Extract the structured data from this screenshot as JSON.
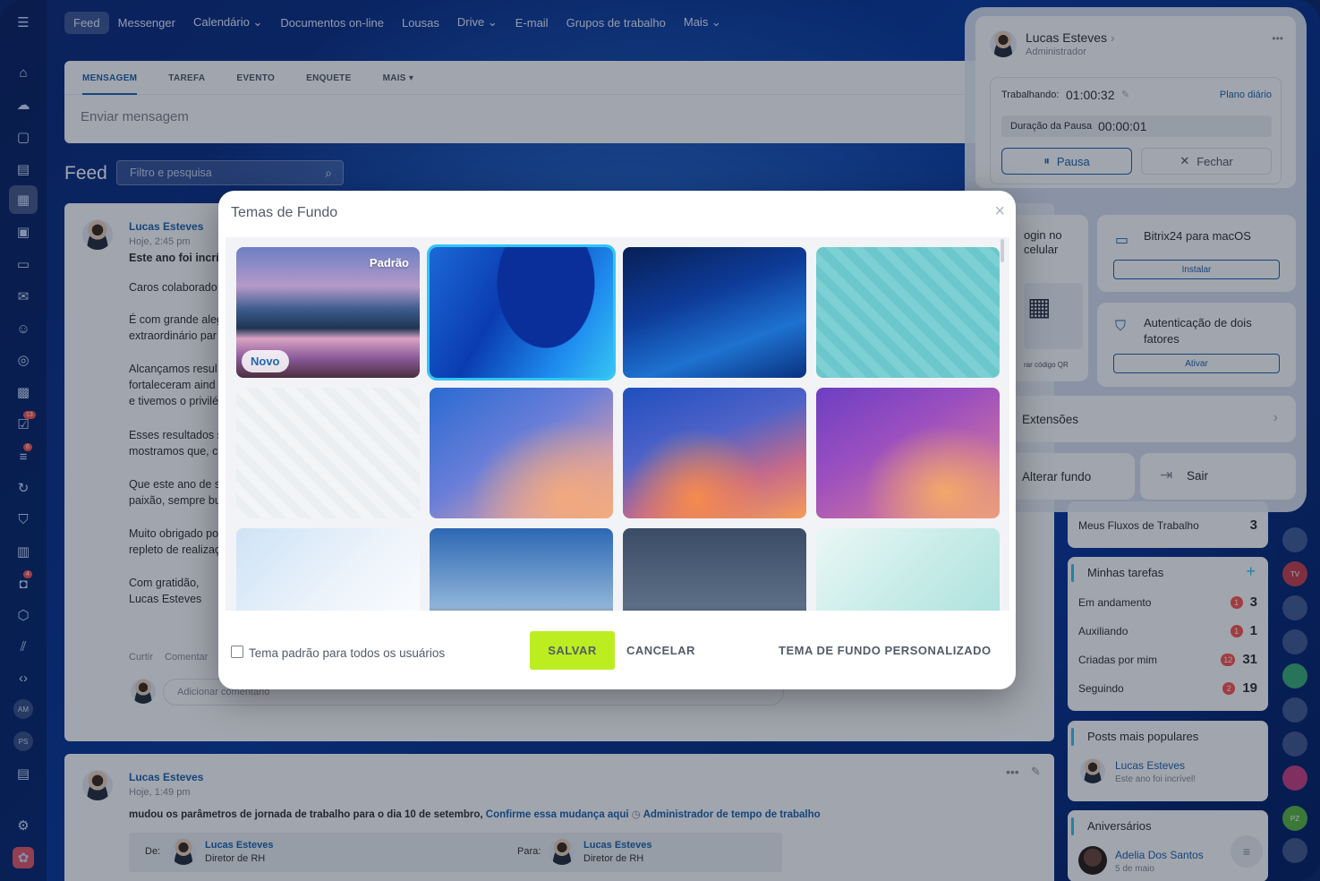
{
  "topnav": [
    "Feed",
    "Messenger",
    "Calendário ⌄",
    "Documentos on-line",
    "Lousas",
    "Drive ⌄",
    "E-mail",
    "Grupos de trabalho",
    "Mais ⌄"
  ],
  "sidebar": {
    "badges": [
      "13",
      "6",
      "4"
    ],
    "avatars": [
      "AM",
      "PS"
    ]
  },
  "composer": {
    "tabs": [
      "MENSAGEM",
      "TAREFA",
      "EVENTO",
      "ENQUETE",
      "MAIS ▾"
    ],
    "placeholder": "Enviar mensagem"
  },
  "feed": {
    "title": "Feed",
    "filter_placeholder": "Filtro e pesquisa"
  },
  "post1": {
    "author": "Lucas Esteves",
    "time": "Hoje, 2:45 pm",
    "title": "Este ano foi incrí",
    "lines": [
      "Caros colaborado",
      "É com grande aleg",
      "extraordinário par",
      "Alcançamos resul",
      "fortaleceram aind",
      "e tivemos o privilé",
      "Esses resultados s",
      "mostramos que, c",
      "Que este ano de s",
      "paixão, sempre bu",
      "Muito obrigado po",
      "repleto de realizaç",
      "Com gratidão,",
      "Lucas Esteves"
    ],
    "like": "Curtir",
    "comment": "Comentar",
    "comment_placeholder": "Adicionar comentário"
  },
  "post2": {
    "author": "Lucas Esteves",
    "time": "Hoje, 1:49 pm",
    "text": "mudou os parâmetros de jornada de trabalho para o dia 10 de setembro,",
    "link1": "Confirme essa mudança aqui",
    "link2": "Administrador de tempo de trabalho",
    "from_label": "De:",
    "to_label": "Para:",
    "from_name": "Lucas Esteves",
    "from_role": "Diretor de RH",
    "to_name": "Lucas Esteves",
    "to_role": "Diretor de RH"
  },
  "profile": {
    "name": "Lucas Esteves",
    "role": "Administrador",
    "working_label": "Trabalhando:",
    "working_time": "01:00:32",
    "plan": "Plano diário",
    "pause_label": "Duração da Pausa",
    "pause_time": "00:00:01",
    "pause_btn": "Pausa",
    "close_btn": "Fechar",
    "qr_title": "ogin no celular",
    "qr_caption": "rar código QR",
    "mac_title": "Bitrix24 para macOS",
    "mac_btn": "Instalar",
    "twofa_title": "Autenticação de dois fatores",
    "twofa_btn": "Ativar",
    "extensions": "Extensões",
    "change_bg": "Alterar fundo",
    "logout": "Sair"
  },
  "widgets": {
    "flows": {
      "label": "Meus Fluxos de Trabalho",
      "count": "3"
    },
    "tasks": {
      "title": "Minhas tarefas",
      "rows": [
        {
          "label": "Em andamento",
          "badge": "1",
          "count": "3"
        },
        {
          "label": "Auxiliando",
          "badge": "1",
          "count": "1"
        },
        {
          "label": "Criadas por mim",
          "badge": "12",
          "count": "31"
        },
        {
          "label": "Seguindo",
          "badge": "2",
          "count": "19"
        }
      ]
    },
    "popular": {
      "title": "Posts mais populares",
      "author": "Lucas Esteves",
      "snippet": "Este ano foi incrível!"
    },
    "birthdays": {
      "title": "Aniversários",
      "name": "Adelia Dos Santos",
      "date": "5 de maio"
    }
  },
  "rightstrip": [
    "TV",
    "PZ"
  ],
  "modal": {
    "title": "Temas de Fundo",
    "tag_default": "Padrão",
    "tag_new": "Novo",
    "checkbox_label": "Tema padrão para todos os usuários",
    "save": "SALVAR",
    "cancel": "CANCELAR",
    "custom": "TEMA DE FUNDO PERSONALIZADO"
  }
}
